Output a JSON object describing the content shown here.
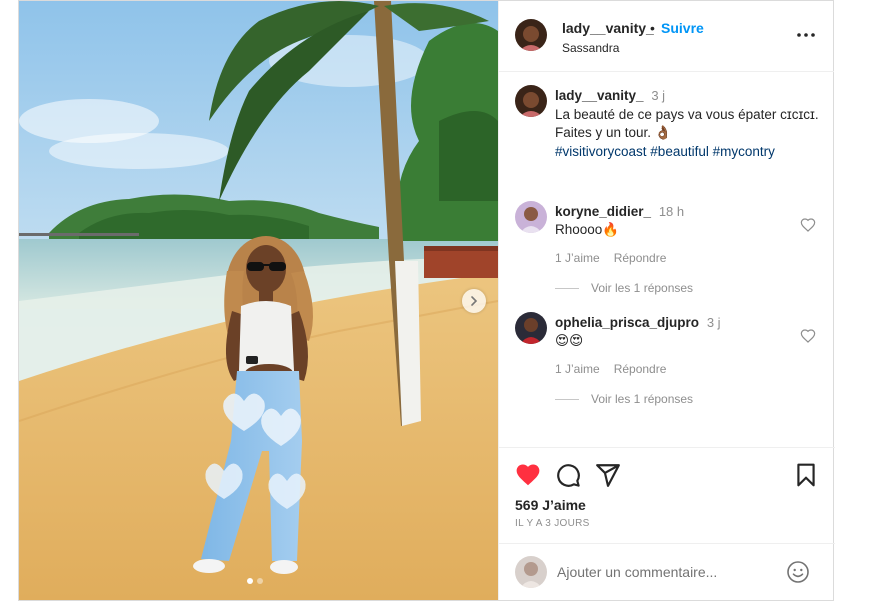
{
  "post": {
    "author": {
      "username": "lady__vanity_",
      "follow_label": "Suivre",
      "bullet": "•",
      "location": "Sassandra"
    },
    "caption": {
      "username": "lady__vanity_",
      "time": "3 j",
      "line1": "La beauté de ce pays va vous épater ᴄɪᴄɪᴄɪ.",
      "line2": "Faites y un tour. 👌🏾",
      "hashtags": [
        "#visitivorycoast",
        "#beautiful",
        "#mycontry"
      ]
    },
    "comments": [
      {
        "username": "koryne_didier_",
        "time": "18 h",
        "text": "Rhoooo🔥",
        "like_label": "1 J’aime",
        "reply_label": "Répondre",
        "view_replies": "Voir les 1 réponses"
      },
      {
        "username": "ophelia_prisca_djupro",
        "time": "3 j",
        "text": "😍😍",
        "like_label": "1 J’aime",
        "reply_label": "Répondre",
        "view_replies": "Voir les 1 réponses"
      }
    ],
    "likes_text": "569 J’aime",
    "posted_ago": "IL Y A 3 JOURS",
    "add_comment": {
      "placeholder": "Ajouter un commentaire..."
    },
    "liked": true,
    "carousel": {
      "current": 1,
      "total": 2
    },
    "colors": {
      "link": "#0095f6",
      "hashtag": "#00376b",
      "heart": "#ff3040",
      "muted": "#8e8e8e"
    },
    "icons": [
      "more-icon",
      "heart-filled-icon",
      "comment-icon",
      "share-icon",
      "bookmark-icon",
      "emoji-icon",
      "chevron-right-icon",
      "heart-outline-icon"
    ]
  }
}
